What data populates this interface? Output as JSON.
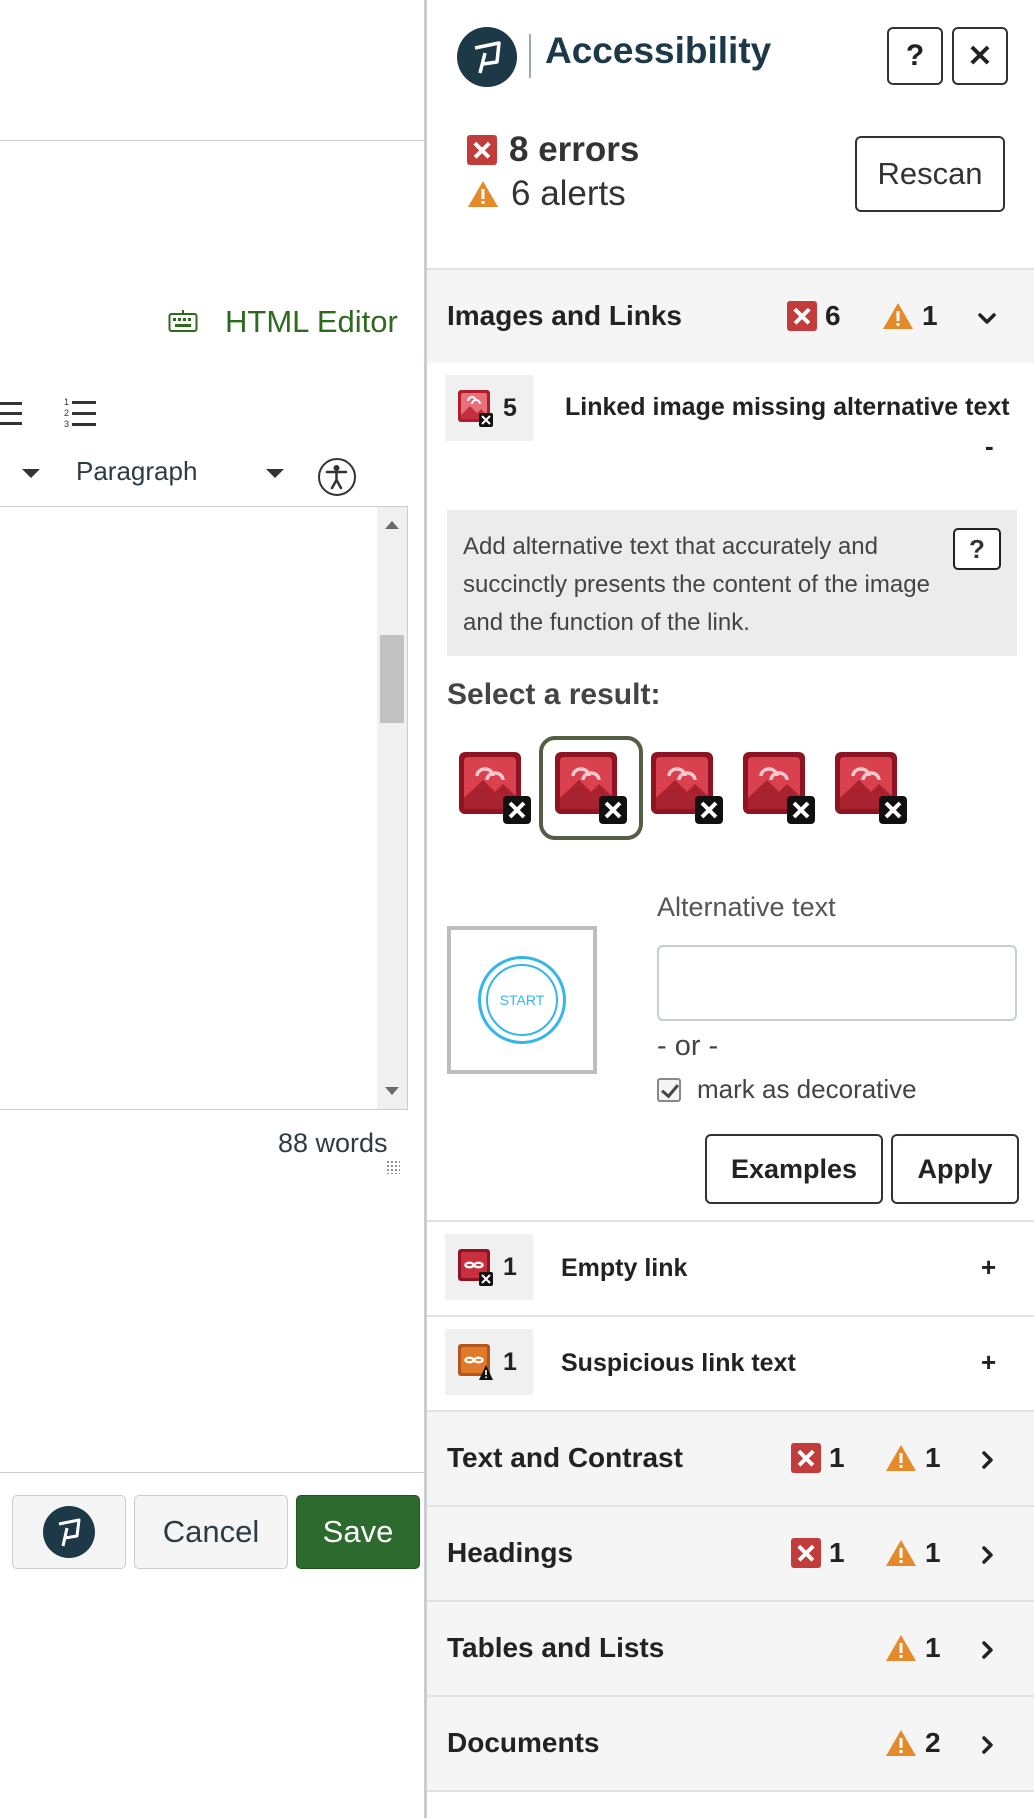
{
  "editor": {
    "html_editor_label": "HTML Editor",
    "block_format": "Paragraph",
    "word_count": "88 words",
    "buttons": {
      "cancel": "Cancel",
      "save": "Save"
    }
  },
  "panel": {
    "title": "Accessibility",
    "help_label": "?",
    "close_label": "✕",
    "summary": {
      "errors": "8 errors",
      "alerts": "6 alerts"
    },
    "rescan_label": "Rescan",
    "sections": [
      {
        "name": "Images and Links",
        "errors": "6",
        "alerts": "1"
      },
      {
        "name": "Text and Contrast",
        "errors": "1",
        "alerts": "1"
      },
      {
        "name": "Headings",
        "errors": "1",
        "alerts": "1"
      },
      {
        "name": "Tables and Lists",
        "alerts": "1"
      },
      {
        "name": "Documents",
        "alerts": "2"
      }
    ],
    "issues": [
      {
        "count": "5",
        "title": "Linked image missing alternative text",
        "toggle": "-"
      },
      {
        "count": "1",
        "title": "Empty link",
        "toggle": "+"
      },
      {
        "count": "1",
        "title": "Suspicious link text",
        "toggle": "+"
      }
    ],
    "detail": {
      "description": "Add alternative text that accurately and succinctly presents the content of the image and the function of the link.",
      "help_label": "?",
      "select_label": "Select a result:",
      "thumbnail_text": "START",
      "alt_text_label": "Alternative text",
      "alt_text_value": "",
      "or_label": "- or -",
      "decorative_label": "mark as decorative",
      "decorative_checked": true,
      "examples_label": "Examples",
      "apply_label": "Apply"
    }
  },
  "colors": {
    "error": "#c23c3c",
    "alert": "#e48a2a",
    "save_button": "#2d6a2d",
    "html_editor": "#2d6a1f",
    "logo_bg": "#1d3847",
    "thumbnail_accent": "#34b6ec"
  }
}
